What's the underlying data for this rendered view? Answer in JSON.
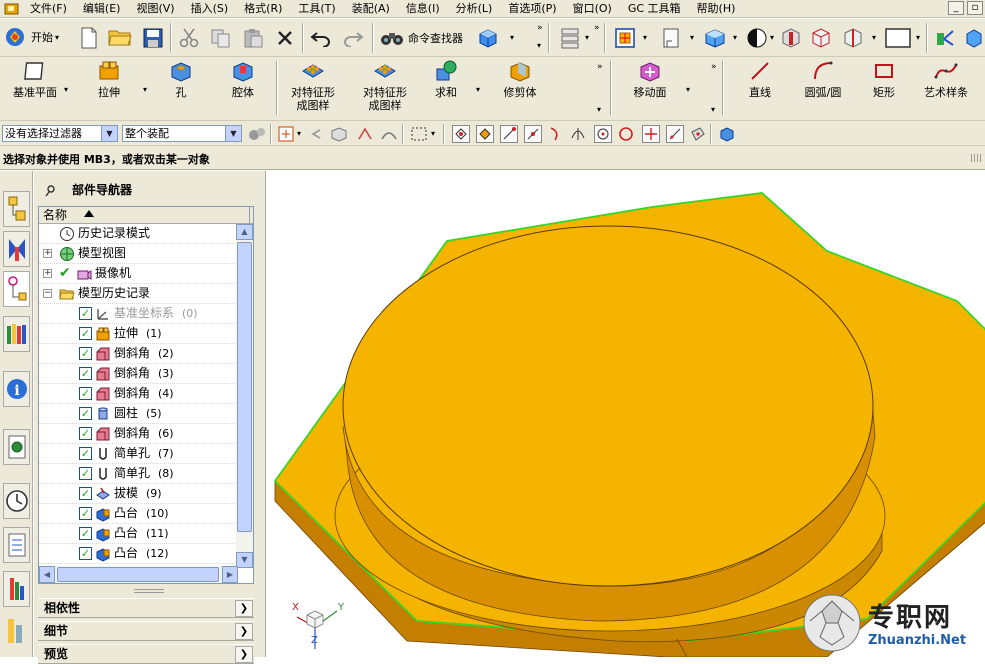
{
  "menubar": {
    "items": [
      "文件(F)",
      "编辑(E)",
      "视图(V)",
      "插入(S)",
      "格式(R)",
      "工具(T)",
      "装配(A)",
      "信息(I)",
      "分析(L)",
      "首选项(P)",
      "窗口(O)",
      "GC 工具箱",
      "帮助(H)"
    ]
  },
  "toolbar1": {
    "start_label": "开始",
    "command_finder_label": "命令查找器"
  },
  "toolbar2": {
    "buttons": [
      "基准平面",
      "拉伸",
      "孔",
      "腔体",
      "对特征形\n成图样",
      "对特征形\n成图样",
      "求和",
      "修剪体",
      "移动面",
      "直线",
      "圆弧/圆",
      "矩形",
      "艺术样条"
    ]
  },
  "toolbar3": {
    "filter_value": "没有选择过滤器",
    "scope_value": "整个装配"
  },
  "cue": {
    "text": "选择对象并使用 MB3，或者双击某一对象"
  },
  "navigator": {
    "title": "部件导航器",
    "column_header": "名称",
    "rows": [
      {
        "name": "历史记录模式",
        "num": ""
      },
      {
        "name": "模型视图",
        "num": ""
      },
      {
        "name": "摄像机",
        "num": ""
      },
      {
        "name": "模型历史记录",
        "num": ""
      },
      {
        "name": "基准坐标系",
        "num": "(0)"
      },
      {
        "name": "拉伸",
        "num": "(1)"
      },
      {
        "name": "倒斜角",
        "num": "(2)"
      },
      {
        "name": "倒斜角",
        "num": "(3)"
      },
      {
        "name": "倒斜角",
        "num": "(4)"
      },
      {
        "name": "圆柱",
        "num": "(5)"
      },
      {
        "name": "倒斜角",
        "num": "(6)"
      },
      {
        "name": "简单孔",
        "num": "(7)"
      },
      {
        "name": "简单孔",
        "num": "(8)"
      },
      {
        "name": "拔模",
        "num": "(9)"
      },
      {
        "name": "凸台",
        "num": "(10)"
      },
      {
        "name": "凸台",
        "num": "(11)"
      },
      {
        "name": "凸台",
        "num": "(12)"
      }
    ],
    "sections": [
      "相依性",
      "细节",
      "预览"
    ]
  },
  "viewport": {
    "triad_labels": [
      "X",
      "Y",
      "Z"
    ],
    "part_color": "#f5b400",
    "edge_color": "#39d42a"
  },
  "watermark": {
    "cn": "专职网",
    "en": "Zhuanzhi.Net"
  }
}
